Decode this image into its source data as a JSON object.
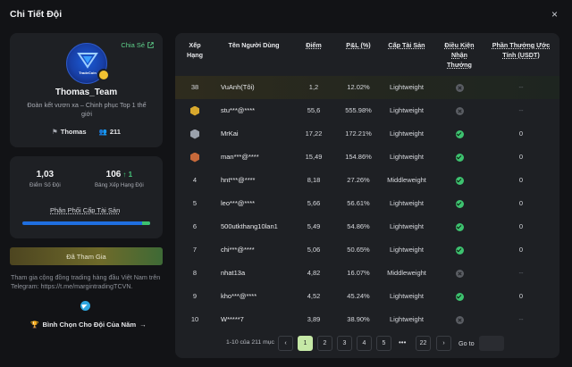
{
  "title": "Chi Tiết Đội",
  "close": "×",
  "profile": {
    "share": "Chia Sẻ",
    "logo_text": "TradeCoin",
    "name": "Thomas_Team",
    "desc": "Đoàn kết vươn xa – Chinh phục Top 1 thế giới",
    "leader": "Thomas",
    "members": "211"
  },
  "stats": {
    "score": "1,03",
    "score_label": "Điểm Số Đội",
    "rank": "106",
    "rank_change": "↑ 1",
    "rank_label": "Bảng Xếp Hạng Đội",
    "dist_title": "Phân Phối Cấp Tài Sản",
    "dist_green_pct": 0.06
  },
  "join": "Đã Tham Gia",
  "telegram_text": "Tham gia cộng đồng trading hàng đầu Việt Nam trên Telegram: https://t.me/margintradingTCVN.",
  "vote": "Bình Chọn Cho Đội Của Năm",
  "table": {
    "headers": {
      "rank": "Xếp Hạng",
      "user": "Tên Người Dùng",
      "points": "Điểm",
      "pnl": "P&L (%)",
      "tier": "Cấp Tài Sản",
      "cond": "Điều Kiện Nhận Thưởng",
      "reward": "Phần Thưởng Ước Tính (USDT)"
    },
    "rows": [
      {
        "rank": "38",
        "medal": "",
        "user": "VuAnh(Tôi)",
        "points": "1,2",
        "pnl": "12.02%",
        "tier": "Lightweight",
        "ok": false,
        "reward": "--"
      },
      {
        "rank": "",
        "medal": "gold",
        "user": "stu***@****",
        "points": "55,6",
        "pnl": "555.98%",
        "tier": "Lightweight",
        "ok": false,
        "reward": "--"
      },
      {
        "rank": "",
        "medal": "silver",
        "user": "MrKai",
        "points": "17,22",
        "pnl": "172.21%",
        "tier": "Lightweight",
        "ok": true,
        "reward": "0"
      },
      {
        "rank": "",
        "medal": "bronze",
        "user": "man***@****",
        "points": "15,49",
        "pnl": "154.86%",
        "tier": "Lightweight",
        "ok": true,
        "reward": "0"
      },
      {
        "rank": "4",
        "medal": "",
        "user": "hnt***@****",
        "points": "8,18",
        "pnl": "27.26%",
        "tier": "Middleweight",
        "ok": true,
        "reward": "0"
      },
      {
        "rank": "5",
        "medal": "",
        "user": "leo***@****",
        "points": "5,66",
        "pnl": "56.61%",
        "tier": "Lightweight",
        "ok": true,
        "reward": "0"
      },
      {
        "rank": "6",
        "medal": "",
        "user": "500utkthang10lan1",
        "points": "5,49",
        "pnl": "54.86%",
        "tier": "Lightweight",
        "ok": true,
        "reward": "0"
      },
      {
        "rank": "7",
        "medal": "",
        "user": "chi***@****",
        "points": "5,06",
        "pnl": "50.65%",
        "tier": "Lightweight",
        "ok": true,
        "reward": "0"
      },
      {
        "rank": "8",
        "medal": "",
        "user": "nhat13a",
        "points": "4,82",
        "pnl": "16.07%",
        "tier": "Middleweight",
        "ok": false,
        "reward": "--"
      },
      {
        "rank": "9",
        "medal": "",
        "user": "kho***@****",
        "points": "4,52",
        "pnl": "45.24%",
        "tier": "Lightweight",
        "ok": true,
        "reward": "0"
      },
      {
        "rank": "10",
        "medal": "",
        "user": "W*****7",
        "points": "3,89",
        "pnl": "38.90%",
        "tier": "Lightweight",
        "ok": false,
        "reward": "--"
      }
    ]
  },
  "pagination": {
    "info": "1-10 của 211 mục",
    "prev": "‹",
    "next": "›",
    "pages": [
      "1",
      "2",
      "3",
      "4",
      "5"
    ],
    "dots": "•••",
    "last": "22",
    "goto": "Go to",
    "active": "1"
  },
  "colors": {
    "accent": "#3dc26f",
    "gold": "#d8a82d",
    "silver": "#9aa1ab",
    "bronze": "#c7693a"
  }
}
